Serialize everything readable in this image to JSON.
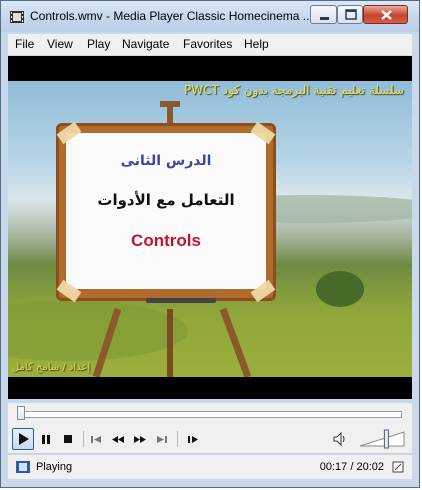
{
  "window": {
    "title": "Controls.wmv - Media Player Classic Homecinema ...",
    "icon": "film-strip-icon",
    "controls": {
      "minimize": "minimize-icon",
      "maximize": "maximize-icon",
      "close": "close-icon"
    }
  },
  "menu": {
    "items": [
      "File",
      "View",
      "Play",
      "Navigate",
      "Favorites",
      "Help"
    ]
  },
  "video": {
    "top_caption": "سلسلة تعليم تقنية البرمجة بدون كود PWCT",
    "board": {
      "line1": "الدرس الثانى",
      "line2": "التعامل مع الأدوات",
      "line3": "Controls"
    },
    "bottom_caption": "إعداد / سامح كامل"
  },
  "seek": {
    "position": 0.0
  },
  "transport": {
    "buttons": [
      "play-icon",
      "pause-icon",
      "stop-icon",
      "skip-back-icon",
      "rewind-icon",
      "fast-forward-icon",
      "skip-forward-icon",
      "frame-step-icon"
    ],
    "volume_icon": "speaker-icon",
    "volume_level": 0.6
  },
  "status": {
    "state": "Playing",
    "time": "00:17 / 20:02"
  },
  "colors": {
    "caption_yellow": "#f2e44a",
    "board_title_blue": "#3a45a8",
    "board_red": "#c8102e",
    "close_red": "#c8432b"
  }
}
